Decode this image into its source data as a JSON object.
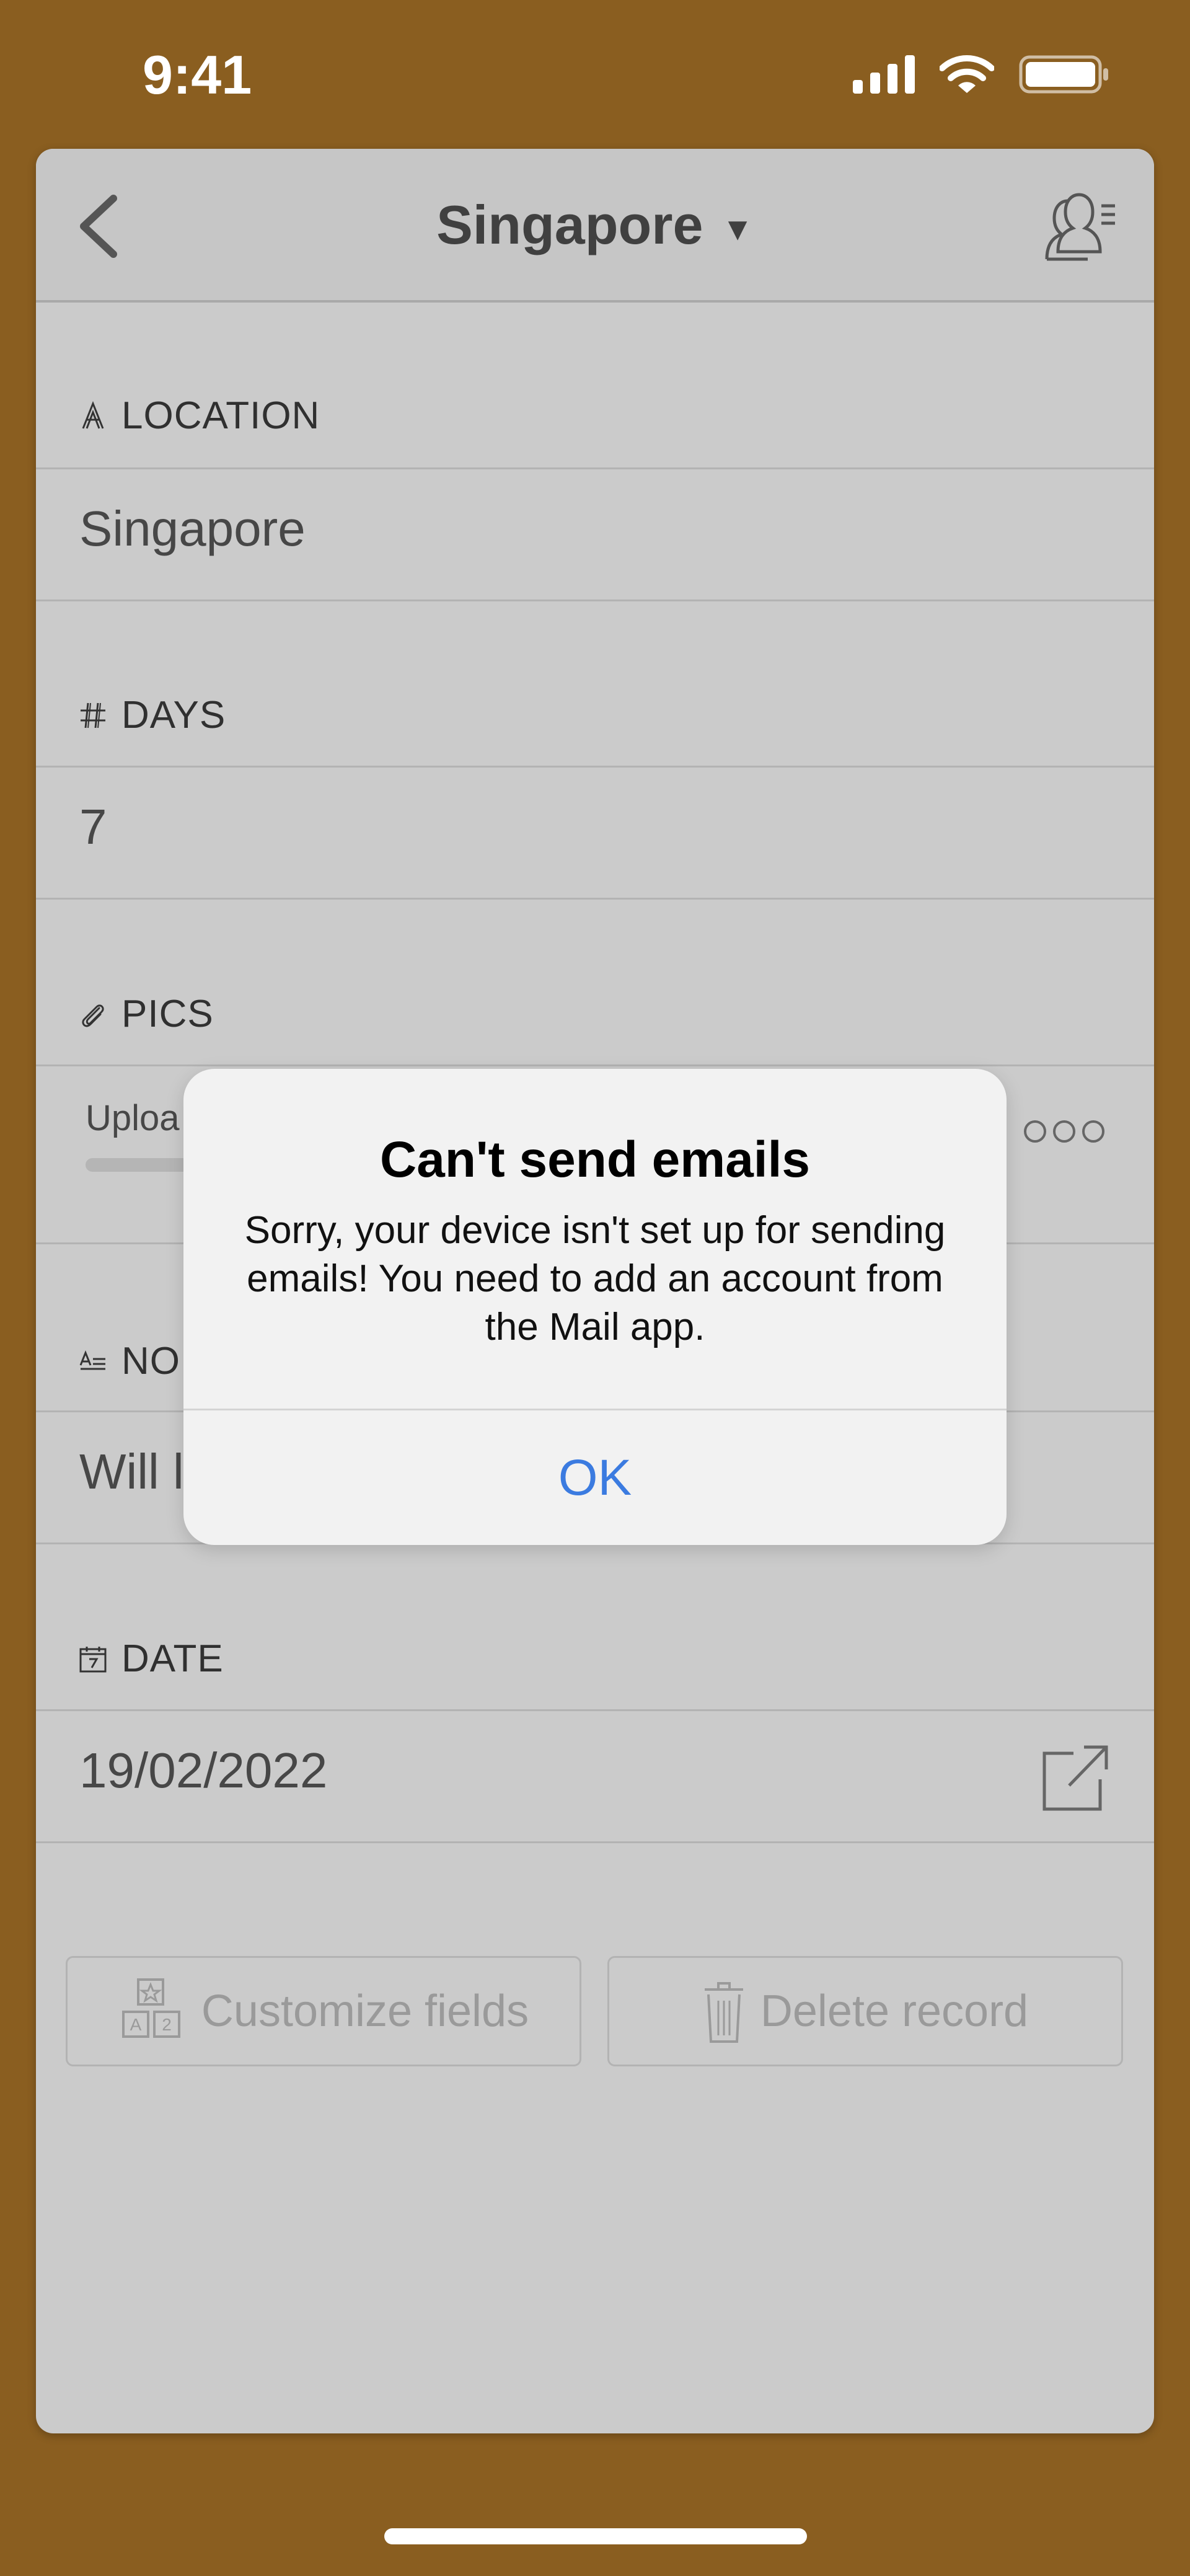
{
  "status_bar": {
    "time": "9:41"
  },
  "nav": {
    "title": "Singapore"
  },
  "fields": {
    "location": {
      "label": "LOCATION",
      "value": "Singapore"
    },
    "days": {
      "label": "DAYS",
      "value": "7"
    },
    "pics": {
      "label": "PICS",
      "upload_text": "Uploa"
    },
    "notes": {
      "label": "NO",
      "value": "Will l"
    },
    "date": {
      "label": "DATE",
      "value": "19/02/2022"
    }
  },
  "actions": {
    "customize_label": "Customize fields",
    "delete_label": "Delete record"
  },
  "alert": {
    "title": "Can't send emails",
    "message": "Sorry, your device isn't set up for sending emails! You need to add an account from the Mail app.",
    "ok_label": "OK"
  },
  "colors": {
    "background": "#8a5e20",
    "card": "#cbcbcb",
    "accent": "#3b7be0"
  },
  "icons": {
    "back": "chevron-left-icon",
    "users": "users-list-icon",
    "location": "text-field-icon",
    "days": "number-field-icon",
    "pics": "paperclip-icon",
    "notes": "long-text-icon",
    "date": "calendar-icon",
    "open": "open-external-icon",
    "more": "more-icon",
    "customize": "blocks-icon",
    "delete": "trash-icon"
  }
}
